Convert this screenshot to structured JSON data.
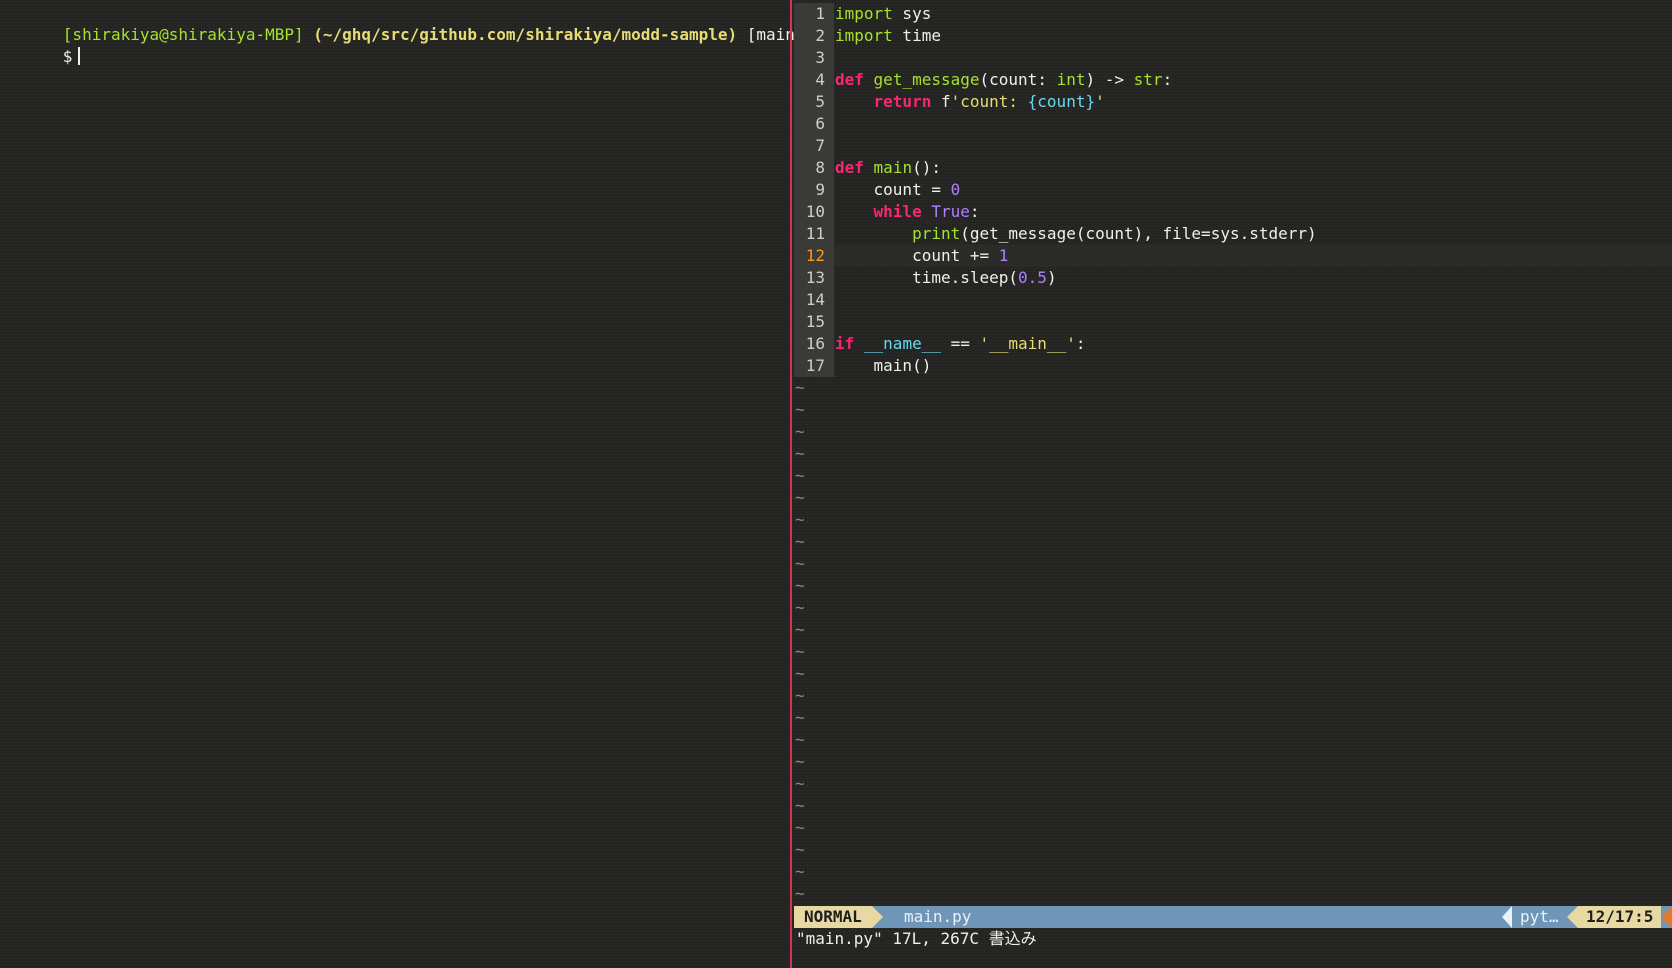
{
  "terminal": {
    "prompt_user": "[shirakiya@shirakiya-MBP]",
    "prompt_path": "(~/ghq/src/github.com/shirakiya/modd-sample)",
    "prompt_branch": "[main]",
    "prompt_symbol": "$"
  },
  "editor": {
    "lines": [
      {
        "n": "1",
        "tokens": [
          {
            "t": "import",
            "c": "kw2"
          },
          {
            "t": " sys",
            "c": "plain"
          }
        ]
      },
      {
        "n": "2",
        "tokens": [
          {
            "t": "import",
            "c": "kw2"
          },
          {
            "t": " time",
            "c": "plain"
          }
        ]
      },
      {
        "n": "3",
        "tokens": []
      },
      {
        "n": "4",
        "tokens": [
          {
            "t": "def",
            "c": "kw"
          },
          {
            "t": " ",
            "c": "plain"
          },
          {
            "t": "get_message",
            "c": "fn"
          },
          {
            "t": "(count: ",
            "c": "plain"
          },
          {
            "t": "int",
            "c": "ty"
          },
          {
            "t": ") -> ",
            "c": "plain"
          },
          {
            "t": "str",
            "c": "ty"
          },
          {
            "t": ":",
            "c": "plain"
          }
        ]
      },
      {
        "n": "5",
        "tokens": [
          {
            "t": "    ",
            "c": "plain"
          },
          {
            "t": "return",
            "c": "kw"
          },
          {
            "t": " f",
            "c": "plain"
          },
          {
            "t": "'count: ",
            "c": "str"
          },
          {
            "t": "{count}",
            "c": "interp"
          },
          {
            "t": "'",
            "c": "str"
          }
        ]
      },
      {
        "n": "6",
        "tokens": []
      },
      {
        "n": "7",
        "tokens": []
      },
      {
        "n": "8",
        "tokens": [
          {
            "t": "def",
            "c": "kw"
          },
          {
            "t": " ",
            "c": "plain"
          },
          {
            "t": "main",
            "c": "fn"
          },
          {
            "t": "():",
            "c": "plain"
          }
        ]
      },
      {
        "n": "9",
        "tokens": [
          {
            "t": "    count = ",
            "c": "plain"
          },
          {
            "t": "0",
            "c": "num"
          }
        ]
      },
      {
        "n": "10",
        "tokens": [
          {
            "t": "    ",
            "c": "plain"
          },
          {
            "t": "while",
            "c": "kw"
          },
          {
            "t": " ",
            "c": "plain"
          },
          {
            "t": "True",
            "c": "const"
          },
          {
            "t": ":",
            "c": "plain"
          }
        ]
      },
      {
        "n": "11",
        "tokens": [
          {
            "t": "        ",
            "c": "plain"
          },
          {
            "t": "print",
            "c": "fn"
          },
          {
            "t": "(get_message(count), file=sys.stderr)",
            "c": "plain"
          }
        ]
      },
      {
        "n": "12",
        "current": true,
        "tokens": [
          {
            "t": "        count += ",
            "c": "plain"
          },
          {
            "t": "1",
            "c": "num"
          }
        ]
      },
      {
        "n": "13",
        "tokens": [
          {
            "t": "        time.sleep(",
            "c": "plain"
          },
          {
            "t": "0.5",
            "c": "num"
          },
          {
            "t": ")",
            "c": "plain"
          }
        ]
      },
      {
        "n": "14",
        "tokens": []
      },
      {
        "n": "15",
        "tokens": []
      },
      {
        "n": "16",
        "tokens": [
          {
            "t": "if",
            "c": "kw"
          },
          {
            "t": " ",
            "c": "plain"
          },
          {
            "t": "__name__",
            "c": "dunder"
          },
          {
            "t": " == ",
            "c": "plain"
          },
          {
            "t": "'__main__'",
            "c": "str"
          },
          {
            "t": ":",
            "c": "plain"
          }
        ]
      },
      {
        "n": "17",
        "tokens": [
          {
            "t": "    main()",
            "c": "plain"
          }
        ]
      }
    ],
    "tilde": "~",
    "tilde_count": 24
  },
  "statusline": {
    "mode": "NORMAL",
    "filename": "main.py",
    "filetype": "pyt…",
    "position": "12/17:5"
  },
  "cmdline": {
    "message": "\"main.py\" 17L, 267C 書込み"
  },
  "colors": {
    "divider": "#d8334d",
    "statusline_bg": "#6f96b8",
    "mode_bg": "#e8d8a4",
    "current_line_number": "#fd971f"
  }
}
